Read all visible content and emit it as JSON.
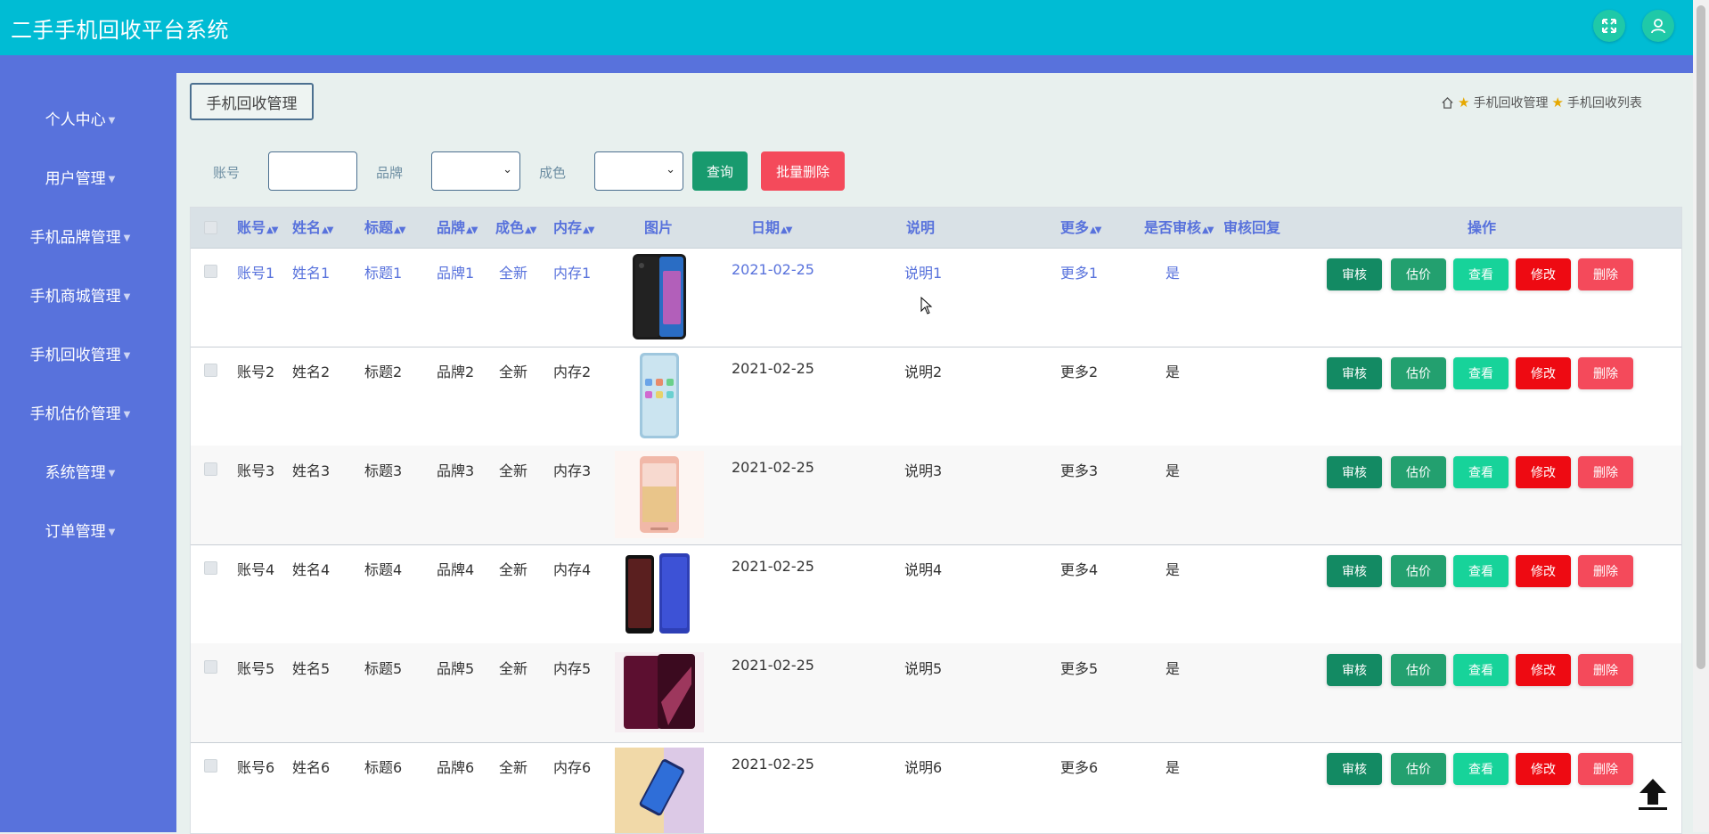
{
  "app": {
    "title": "二手手机回收平台系统"
  },
  "header": {
    "fullscreen_icon": "expand-icon",
    "user_icon": "user-icon"
  },
  "sidebar": {
    "items": [
      {
        "label": "个人中心"
      },
      {
        "label": "用户管理"
      },
      {
        "label": "手机品牌管理"
      },
      {
        "label": "手机商城管理"
      },
      {
        "label": "手机回收管理"
      },
      {
        "label": "手机估价管理"
      },
      {
        "label": "系统管理"
      },
      {
        "label": "订单管理"
      }
    ]
  },
  "module_tab": {
    "label": "手机回收管理"
  },
  "breadcrumb": {
    "home_icon": "home-icon",
    "items": [
      "手机回收管理",
      "手机回收列表"
    ]
  },
  "search": {
    "account_label": "账号",
    "account_value": "",
    "brand_label": "品牌",
    "brand_value": "",
    "condition_label": "成色",
    "condition_value": "",
    "query_button": "查询",
    "batch_delete_button": "批量删除"
  },
  "table": {
    "headers": {
      "account": "账号",
      "name": "姓名",
      "title": "标题",
      "brand": "品牌",
      "condition": "成色",
      "memory": "内存",
      "image": "图片",
      "date": "日期",
      "description": "说明",
      "more": "更多",
      "reviewed": "是否审核",
      "review_reply": "审核回复",
      "actions": "操作"
    },
    "action_labels": {
      "review": "审核",
      "estimate": "估价",
      "view": "查看",
      "edit": "修改",
      "delete": "删除"
    },
    "rows": [
      {
        "account": "账号1",
        "name": "姓名1",
        "title": "标题1",
        "brand": "品牌1",
        "condition": "全新",
        "memory": "内存1",
        "date": "2021-02-25",
        "description": "说明1",
        "more": "更多1",
        "reviewed": "是",
        "review_reply": ""
      },
      {
        "account": "账号2",
        "name": "姓名2",
        "title": "标题2",
        "brand": "品牌2",
        "condition": "全新",
        "memory": "内存2",
        "date": "2021-02-25",
        "description": "说明2",
        "more": "更多2",
        "reviewed": "是",
        "review_reply": ""
      },
      {
        "account": "账号3",
        "name": "姓名3",
        "title": "标题3",
        "brand": "品牌3",
        "condition": "全新",
        "memory": "内存3",
        "date": "2021-02-25",
        "description": "说明3",
        "more": "更多3",
        "reviewed": "是",
        "review_reply": ""
      },
      {
        "account": "账号4",
        "name": "姓名4",
        "title": "标题4",
        "brand": "品牌4",
        "condition": "全新",
        "memory": "内存4",
        "date": "2021-02-25",
        "description": "说明4",
        "more": "更多4",
        "reviewed": "是",
        "review_reply": ""
      },
      {
        "account": "账号5",
        "name": "姓名5",
        "title": "标题5",
        "brand": "品牌5",
        "condition": "全新",
        "memory": "内存5",
        "date": "2021-02-25",
        "description": "说明5",
        "more": "更多5",
        "reviewed": "是",
        "review_reply": ""
      },
      {
        "account": "账号6",
        "name": "姓名6",
        "title": "标题6",
        "brand": "品牌6",
        "condition": "全新",
        "memory": "内存6",
        "date": "2021-02-25",
        "description": "说明6",
        "more": "更多6",
        "reviewed": "是",
        "review_reply": ""
      }
    ]
  },
  "colors": {
    "header_bg": "#00bcd4",
    "sidebar_bg": "#5872dc",
    "review_btn": "#138a63",
    "estimate_btn": "#23a06f",
    "view_btn": "#17d39a",
    "edit_btn": "#ee0a12",
    "delete_btn": "#f44a5b"
  },
  "back_to_top_icon": "arrow-up-icon"
}
